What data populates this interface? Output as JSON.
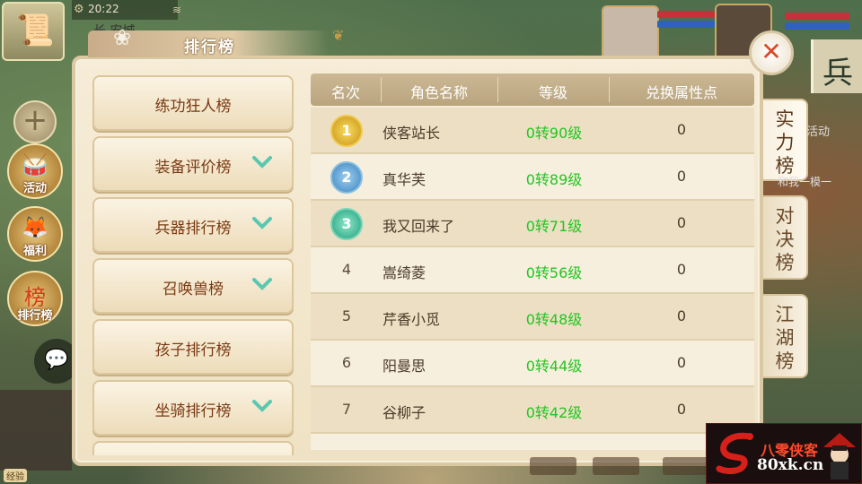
{
  "status": {
    "time": "20:22",
    "location": "长 安城"
  },
  "left_icons": [
    {
      "label": "活动",
      "icon": "drum-icon"
    },
    {
      "label": "福利",
      "icon": "fox-icon"
    },
    {
      "label": "排行榜",
      "icon": "ranking-scroll-icon"
    }
  ],
  "hud": {
    "exp_label": "经验"
  },
  "panel": {
    "title": "排行榜",
    "close_label": "✕"
  },
  "sidebar": {
    "items": [
      {
        "label": "练功狂人榜",
        "expandable": false
      },
      {
        "label": "装备评价榜",
        "expandable": true
      },
      {
        "label": "兵器排行榜",
        "expandable": true
      },
      {
        "label": "召唤兽榜",
        "expandable": true
      },
      {
        "label": "孩子排行榜",
        "expandable": false
      },
      {
        "label": "坐骑排行榜",
        "expandable": true
      },
      {
        "label": "",
        "expandable": false
      }
    ]
  },
  "table": {
    "headers": [
      "名次",
      "角色名称",
      "等级",
      "兑换属性点"
    ],
    "rows": [
      {
        "rank": "1",
        "medal": true,
        "name": "侠客站长",
        "level": "0转90级",
        "points": "0"
      },
      {
        "rank": "2",
        "medal": true,
        "name": "真华芙",
        "level": "0转89级",
        "points": "0"
      },
      {
        "rank": "3",
        "medal": true,
        "name": "我又回来了",
        "level": "0转71级",
        "points": "0"
      },
      {
        "rank": "4",
        "medal": false,
        "name": "嵩绮菱",
        "level": "0转56级",
        "points": "0"
      },
      {
        "rank": "5",
        "medal": false,
        "name": "芹香小觅",
        "level": "0转48级",
        "points": "0"
      },
      {
        "rank": "6",
        "medal": false,
        "name": "阳曼思",
        "level": "0转44级",
        "points": "0"
      },
      {
        "rank": "7",
        "medal": false,
        "name": "谷柳子",
        "level": "0转42级",
        "points": "0"
      }
    ]
  },
  "right_tabs": [
    {
      "label": "实力榜",
      "active": true
    },
    {
      "label": "对决榜",
      "active": false
    },
    {
      "label": "江湖榜",
      "active": false
    }
  ],
  "background_text": {
    "activity": "活动",
    "with_me": "和我一模一"
  },
  "watermark": {
    "brand": "八零侠客",
    "site": "80xk.cn"
  },
  "colors": {
    "level_green": "#22c622",
    "close_red": "#d84a2a",
    "title_brown": "#7a3a14"
  }
}
